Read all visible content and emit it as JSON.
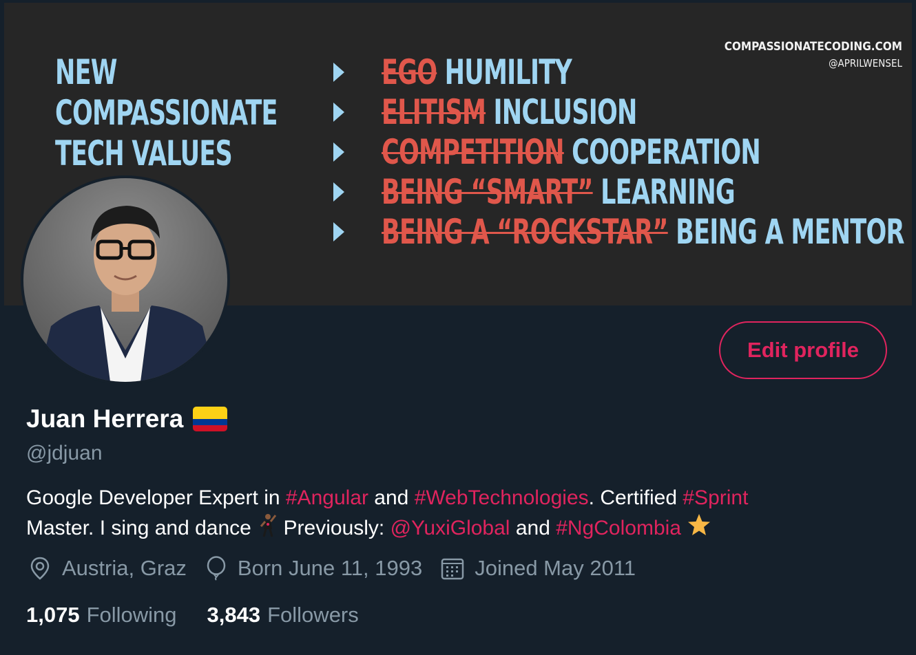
{
  "banner": {
    "site": "COMPASSIONATECODING.COM",
    "site_handle": "@APRILWENSEL",
    "headline": [
      "NEW",
      "COMPASSIONATE",
      "TECH VALUES"
    ],
    "values": [
      {
        "old": "EGO",
        "new": "HUMILITY"
      },
      {
        "old": "ELITISM",
        "new": "INCLUSION"
      },
      {
        "old": "COMPETITION",
        "new": "COOPERATION"
      },
      {
        "old": "BEING “SMART”",
        "new": "LEARNING"
      },
      {
        "old": "BEING A “ROCKSTAR”",
        "new": "BEING A MENTOR"
      }
    ]
  },
  "profile": {
    "name": "Juan Herrera",
    "handle": "@jdjuan",
    "edit_label": "Edit profile",
    "bio": {
      "t1": "Google Developer Expert in ",
      "h1": "#Angular",
      "t2": " and ",
      "h2": "#WebTechnologies",
      "t3": ". Certified ",
      "h3": "#Sprint",
      "t4": " Master. I sing and dance ",
      "t5": " Previously: ",
      "m1": "@YuxiGlobal",
      "t6": " and ",
      "h4": "#NgColombia"
    },
    "location": "Austria, Graz",
    "birthday": "Born June 11, 1993",
    "joined": "Joined May 2011",
    "following_count": "1,075",
    "following_label": "Following",
    "followers_count": "3,843",
    "followers_label": "Followers"
  },
  "colors": {
    "background": "#15202b",
    "accent": "#e0245e",
    "muted": "#8899a6",
    "banner_blue": "#9fd5f2",
    "banner_red": "#e0574b"
  },
  "icons": [
    "location-icon",
    "balloon-icon",
    "calendar-icon",
    "colombia-flag-icon",
    "dancer-icon",
    "star-icon"
  ]
}
